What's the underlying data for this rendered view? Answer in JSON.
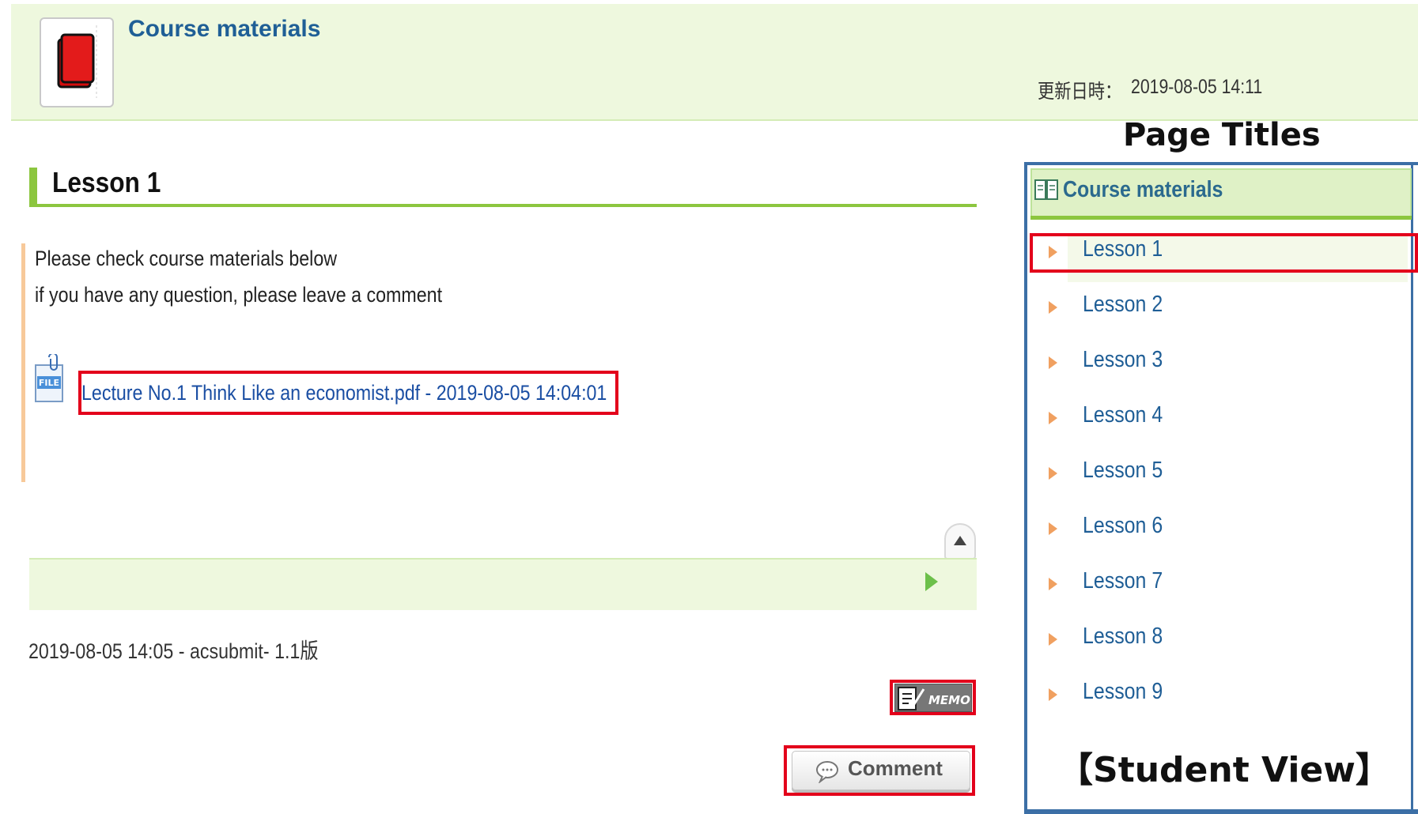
{
  "header": {
    "title": "Course materials",
    "updated_label": "更新日時：",
    "updated_value": "2019-08-05 14:11"
  },
  "content": {
    "lesson_title": "Lesson 1",
    "body_lines": [
      "Please check course materials below",
      "if you have any question, please leave a comment"
    ],
    "file_icon_text": "FILE",
    "file_link": "Lecture No.1 Think Like an economist.pdf - 2019-08-05 14:04:01",
    "footer_meta": "2019-08-05 14:05 - acsubmit- 1.1版",
    "memo_label": "MEMO",
    "comment_label": "Comment"
  },
  "sidebar": {
    "annotation_title": "Page Titles",
    "title": "Course materials",
    "items": [
      {
        "label": "Lesson 1",
        "active": true
      },
      {
        "label": "Lesson 2",
        "active": false
      },
      {
        "label": "Lesson 3",
        "active": false
      },
      {
        "label": "Lesson 4",
        "active": false
      },
      {
        "label": "Lesson 5",
        "active": false
      },
      {
        "label": "Lesson 6",
        "active": false
      },
      {
        "label": "Lesson 7",
        "active": false
      },
      {
        "label": "Lesson 8",
        "active": false
      },
      {
        "label": "Lesson 9",
        "active": false
      }
    ],
    "annotation_footer": "【Student View】"
  },
  "colors": {
    "accent_green": "#8cc63f",
    "header_bg": "#eef8de",
    "highlight_red": "#e3001b",
    "link_blue": "#1a4ea3",
    "frame_blue": "#3c6fa6"
  },
  "icons": [
    "book-icon",
    "file-icon",
    "scroll-top-icon",
    "next-arrow-icon",
    "memo-icon",
    "comment-bubble-icon",
    "sidebar-book-icon",
    "lesson-arrow-icon"
  ]
}
